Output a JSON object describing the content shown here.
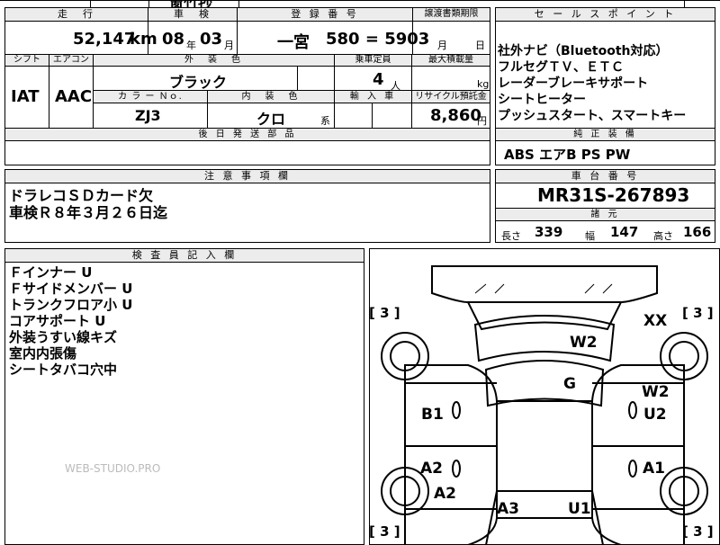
{
  "top_fragment": "窗竹抄",
  "main": {
    "headers": {
      "mileage": "走　行",
      "inspection": "車　検",
      "registration": "登 録 番 号",
      "transfer_deadline": "譲渡書類期限",
      "shift": "シフト",
      "aircon": "エアコン",
      "exterior_color": "外　装　色",
      "capacity": "乗車定員",
      "max_load": "最大積載量",
      "color_no": "カ ラ ー Ｎｏ.",
      "interior_color": "内　装　色",
      "import": "輸 入 車",
      "recycle_deposit": "リサイクル預託金",
      "later_parts": "後 日 発 送 部 品"
    },
    "values": {
      "mileage_value": "52,147",
      "mileage_unit": "km",
      "inspection_year": "08",
      "inspection_year_unit": "年",
      "inspection_month": "03",
      "inspection_month_unit": "月",
      "registration_area": "一宮",
      "registration_number": "580 = 5903",
      "deadline_month_unit": "月",
      "deadline_day_unit": "日",
      "shift_value": "IAT",
      "aircon_value": "AAC",
      "exterior_color_value": "ブラック",
      "capacity_value": "4",
      "capacity_unit": "人",
      "load_unit": "kg",
      "color_no_value": "ZJ3",
      "interior_color_value": "クロ",
      "interior_color_suffix": "系",
      "recycle_value": "8,860",
      "recycle_unit": "円"
    }
  },
  "sales_points": {
    "header": "セ ー ル ス ポ イ ン ト",
    "items": [
      "社外ナビ（Bluetooth対応）",
      "フルセグＴＶ、ＥＴＣ",
      "レーダーブレーキサポート",
      "シートヒーター",
      "プッシュスタート、スマートキー"
    ]
  },
  "genuine_equipment": {
    "header": "純 正 装 備",
    "value": "ABS エアB PS PW"
  },
  "notes": {
    "header": "注 意 事 項 欄",
    "lines": [
      "ドラレコＳＤカード欠",
      "車検Ｒ８年３月２６日迄"
    ]
  },
  "chassis": {
    "header": "車 台 番 号",
    "value": "MR31S-267893"
  },
  "dimensions": {
    "header": "諸 元",
    "length_label": "長さ",
    "length_value": "339",
    "width_label": "幅",
    "width_value": "147",
    "height_label": "高さ",
    "height_value": "166"
  },
  "inspector": {
    "header": "検 査 員 記 入 欄",
    "lines": [
      "Ｆインナー U",
      "Ｆサイドメンバー U",
      "トランクフロア小 U",
      "コアサポート U",
      "外装うすい線キズ",
      "室内内張傷",
      "シートタバコ穴中"
    ]
  },
  "watermark": "WEB-STUDIO.PRO",
  "diagram": {
    "labels": {
      "w2_top": "W2",
      "xx": "XX",
      "g": "G",
      "w2_right": "W2",
      "u2": "U2",
      "b1": "B1",
      "a2_left": "A2",
      "a1": "A1",
      "a2_lower": "A2",
      "a3": "A3",
      "u1": "U1"
    },
    "brackets": {
      "top_left": "[ 3 ]",
      "top_right": "[ 3 ]",
      "bottom_left": "[ 3 ]",
      "bottom_right": "[ 3 ]"
    }
  }
}
